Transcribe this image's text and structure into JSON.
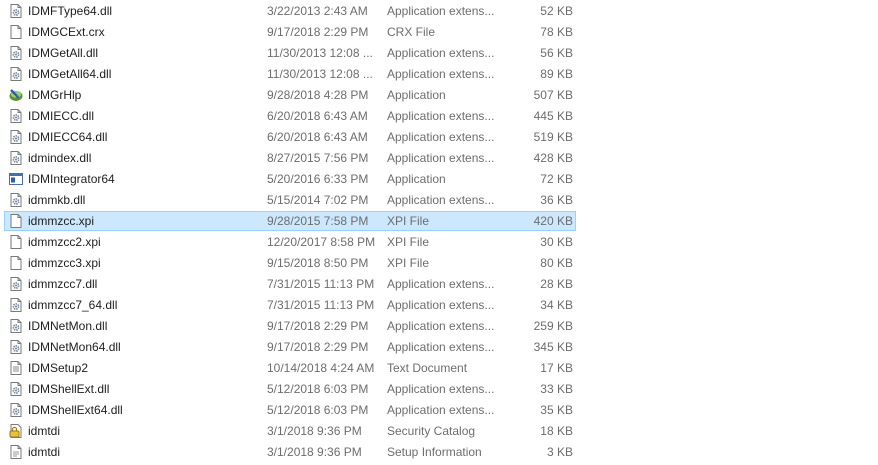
{
  "files": [
    {
      "name": "IDMFType64.dll",
      "date": "3/22/2013 2:43 AM",
      "type": "Application extens...",
      "size": "52 KB",
      "icon": "dll-gear-icon"
    },
    {
      "name": "IDMGCExt.crx",
      "date": "9/17/2018 2:29 PM",
      "type": "CRX File",
      "size": "78 KB",
      "icon": "blank-file-icon"
    },
    {
      "name": "IDMGetAll.dll",
      "date": "11/30/2013 12:08 ...",
      "type": "Application extens...",
      "size": "56 KB",
      "icon": "dll-gear-icon"
    },
    {
      "name": "IDMGetAll64.dll",
      "date": "11/30/2013 12:08 ...",
      "type": "Application extens...",
      "size": "89 KB",
      "icon": "dll-gear-icon"
    },
    {
      "name": "IDMGrHlp",
      "date": "9/28/2018 4:28 PM",
      "type": "Application",
      "size": "507 KB",
      "icon": "idm-app-icon"
    },
    {
      "name": "IDMIECC.dll",
      "date": "6/20/2018 6:43 AM",
      "type": "Application extens...",
      "size": "445 KB",
      "icon": "dll-gear-icon"
    },
    {
      "name": "IDMIECC64.dll",
      "date": "6/20/2018 6:43 AM",
      "type": "Application extens...",
      "size": "519 KB",
      "icon": "dll-gear-icon"
    },
    {
      "name": "idmindex.dll",
      "date": "8/27/2015 7:56 PM",
      "type": "Application extens...",
      "size": "428 KB",
      "icon": "dll-gear-icon"
    },
    {
      "name": "IDMIntegrator64",
      "date": "5/20/2016 6:33 PM",
      "type": "Application",
      "size": "72 KB",
      "icon": "window-app-icon"
    },
    {
      "name": "idmmkb.dll",
      "date": "5/15/2014 7:02 PM",
      "type": "Application extens...",
      "size": "36 KB",
      "icon": "dll-gear-icon"
    },
    {
      "name": "idmmzcc.xpi",
      "date": "9/28/2015 7:58 PM",
      "type": "XPI File",
      "size": "420 KB",
      "icon": "blank-file-icon",
      "selected": true
    },
    {
      "name": "idmmzcc2.xpi",
      "date": "12/20/2017 8:58 PM",
      "type": "XPI File",
      "size": "30 KB",
      "icon": "blank-file-icon"
    },
    {
      "name": "idmmzcc3.xpi",
      "date": "9/15/2018 8:50 PM",
      "type": "XPI File",
      "size": "80 KB",
      "icon": "blank-file-icon"
    },
    {
      "name": "idmmzcc7.dll",
      "date": "7/31/2015 11:13 PM",
      "type": "Application extens...",
      "size": "28 KB",
      "icon": "dll-gear-icon"
    },
    {
      "name": "idmmzcc7_64.dll",
      "date": "7/31/2015 11:13 PM",
      "type": "Application extens...",
      "size": "34 KB",
      "icon": "dll-gear-icon"
    },
    {
      "name": "IDMNetMon.dll",
      "date": "9/17/2018 2:29 PM",
      "type": "Application extens...",
      "size": "259 KB",
      "icon": "dll-gear-icon"
    },
    {
      "name": "IDMNetMon64.dll",
      "date": "9/17/2018 2:29 PM",
      "type": "Application extens...",
      "size": "345 KB",
      "icon": "dll-gear-icon"
    },
    {
      "name": "IDMSetup2",
      "date": "10/14/2018 4:24 AM",
      "type": "Text Document",
      "size": "17 KB",
      "icon": "text-document-icon"
    },
    {
      "name": "IDMShellExt.dll",
      "date": "5/12/2018 6:03 PM",
      "type": "Application extens...",
      "size": "33 KB",
      "icon": "dll-gear-icon"
    },
    {
      "name": "IDMShellExt64.dll",
      "date": "5/12/2018 6:03 PM",
      "type": "Application extens...",
      "size": "35 KB",
      "icon": "dll-gear-icon"
    },
    {
      "name": "idmtdi",
      "date": "3/1/2018 9:36 PM",
      "type": "Security Catalog",
      "size": "18 KB",
      "icon": "security-catalog-icon"
    },
    {
      "name": "idmtdi",
      "date": "3/1/2018 9:36 PM",
      "type": "Setup Information",
      "size": "3 KB",
      "icon": "setup-information-icon"
    }
  ]
}
